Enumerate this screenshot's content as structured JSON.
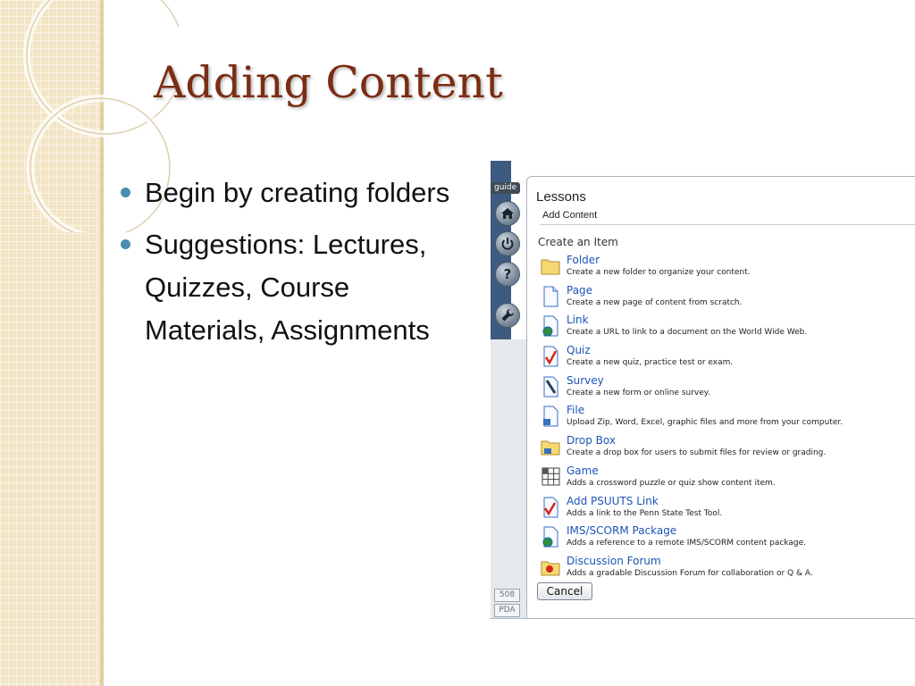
{
  "slide": {
    "title": "Adding Content",
    "bullets": [
      "Begin by creating folders",
      "Suggestions: Lectures, Quizzes, Course Materials, Assignments"
    ]
  },
  "screenshot": {
    "guide_label": "guide",
    "nav_icons": [
      "home-icon",
      "power-icon",
      "help-icon",
      "wrench-icon"
    ],
    "help_glyph": "?",
    "panel_title": "Lessons",
    "panel_subtitle": "Add Content",
    "section_label": "Create an Item",
    "items": [
      {
        "name": "Folder",
        "desc": "Create a new folder to organize your content.",
        "icon": "folder-icon"
      },
      {
        "name": "Page",
        "desc": "Create a new page of content from scratch.",
        "icon": "page-icon"
      },
      {
        "name": "Link",
        "desc": "Create a URL to link to a document on the World Wide Web.",
        "icon": "link-icon"
      },
      {
        "name": "Quiz",
        "desc": "Create a new quiz, practice test or exam.",
        "icon": "quiz-icon"
      },
      {
        "name": "Survey",
        "desc": "Create a new form or online survey.",
        "icon": "survey-icon"
      },
      {
        "name": "File",
        "desc": "Upload Zip, Word, Excel, graphic files and more from your computer.",
        "icon": "file-icon"
      },
      {
        "name": "Drop Box",
        "desc": "Create a drop box for users to submit files for review or grading.",
        "icon": "drop-box-icon"
      },
      {
        "name": "Game",
        "desc": "Adds a crossword puzzle or quiz show content item.",
        "icon": "game-icon"
      },
      {
        "name": "Add PSUUTS Link",
        "desc": "Adds a link to the Penn State Test Tool.",
        "icon": "psuuts-link-icon"
      },
      {
        "name": "IMS/SCORM Package",
        "desc": "Adds a reference to a remote IMS/SCORM content package.",
        "icon": "scorm-package-icon"
      },
      {
        "name": "Discussion Forum",
        "desc": "Adds a gradable Discussion Forum for collaboration or Q & A.",
        "icon": "discussion-forum-icon"
      }
    ],
    "cancel_label": "Cancel",
    "footer_tags": [
      "508",
      "PDA"
    ]
  }
}
